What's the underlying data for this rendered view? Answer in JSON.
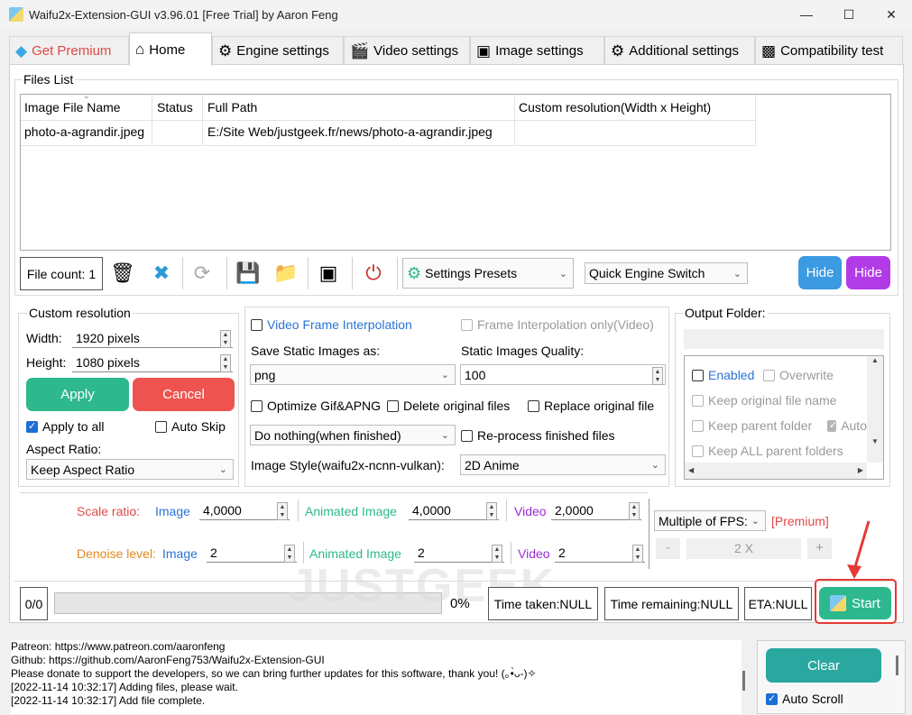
{
  "window": {
    "title": "Waifu2x-Extension-GUI v3.96.01 [Free Trial] by Aaron Feng",
    "minimize_icon": "minimize-icon",
    "maximize_icon": "maximize-icon",
    "close_icon": "close-icon"
  },
  "tabs": [
    {
      "label": "Get Premium",
      "icon": "gem-icon"
    },
    {
      "label": "Home",
      "icon": "home-icon"
    },
    {
      "label": "Engine settings",
      "icon": "engine-icon"
    },
    {
      "label": "Video settings",
      "icon": "clapper-icon"
    },
    {
      "label": "Image settings",
      "icon": "picture-icon"
    },
    {
      "label": "Additional settings",
      "icon": "gear-icon"
    },
    {
      "label": "Compatibility test",
      "icon": "monitor-icon"
    }
  ],
  "files": {
    "group_label": "Files List",
    "columns": [
      "Image File Name",
      "Status",
      "Full Path",
      "Custom resolution(Width x Height)"
    ],
    "rows": [
      [
        "photo-a-agrandir.jpeg",
        "",
        "E:/Site Web/justgeek.fr/news/photo-a-agrandir.jpeg",
        ""
      ]
    ],
    "file_count": "File count: 1",
    "settings_presets": "Settings Presets",
    "quick_engine": "Quick Engine Switch",
    "hide1": "Hide",
    "hide2": "Hide"
  },
  "custom_res": {
    "label": "Custom resolution",
    "width_label": "Width:",
    "width_value": "1920 pixels",
    "height_label": "Height:",
    "height_value": "1080 pixels",
    "apply": "Apply",
    "cancel": "Cancel",
    "apply_all": "Apply to all",
    "auto_skip": "Auto Skip",
    "aspect_label": "Aspect Ratio:",
    "aspect_value": "Keep Aspect Ratio"
  },
  "middle": {
    "vfi": "Video Frame Interpolation",
    "fi_only": "Frame Interpolation only(Video)",
    "save_as_label": "Save Static Images as:",
    "save_as_value": "png",
    "quality_label": "Static Images Quality:",
    "quality_value": "100",
    "opt_gif": "Optimize Gif&APNG",
    "del_orig": "Delete original files",
    "replace_orig": "Replace original file",
    "finished_action": "Do nothing(when finished)",
    "reprocess": "Re-process finished files",
    "style_label": "Image Style(waifu2x-ncnn-vulkan):",
    "style_value": "2D Anime"
  },
  "output": {
    "label": "Output Folder:",
    "enabled": "Enabled",
    "overwrite": "Overwrite",
    "keep_name": "Keep original file name",
    "keep_parent": "Keep parent folder",
    "auto": "Auto",
    "keep_all": "Keep ALL parent folders"
  },
  "scale": {
    "scale_label": "Scale ratio:",
    "image_label": "Image",
    "image_value": "4,0000",
    "anim_label": "Animated Image",
    "anim_value": "4,0000",
    "video_label": "Video",
    "video_value": "2,0000",
    "denoise_label": "Denoise level:",
    "d_image_value": "2",
    "d_anim_value": "2",
    "d_video_value": "2",
    "fps_value": "Multiple of FPS:",
    "premium": "[Premium]",
    "minus": "-",
    "fps_mult": "2 X",
    "plus": "+"
  },
  "progress": {
    "counter": "0/0",
    "percent": "0%",
    "fill": 0,
    "time_taken": "Time taken:NULL",
    "time_remaining": "Time remaining:NULL",
    "eta": "ETA:NULL",
    "start": "Start"
  },
  "log": [
    "Patreon: https://www.patreon.com/aaronfeng",
    "Github: https://github.com/AaronFeng753/Waifu2x-Extension-GUI",
    "Please donate to support the developers, so we can bring further updates for this software, thank you! (｡•̀ᴗ-)✧",
    "[2022-11-14 10:32:17] Adding files, please wait.",
    "[2022-11-14 10:32:17] Add file complete."
  ],
  "log_controls": {
    "clear": "Clear",
    "auto_scroll": "Auto Scroll"
  },
  "watermark": "JUSTGEEK",
  "colors": {
    "teal": "#2db88e",
    "red": "#ef5350",
    "blue_btn": "#3b9ae1",
    "purple_btn": "#b23be8",
    "highlight_red": "#e53935"
  }
}
